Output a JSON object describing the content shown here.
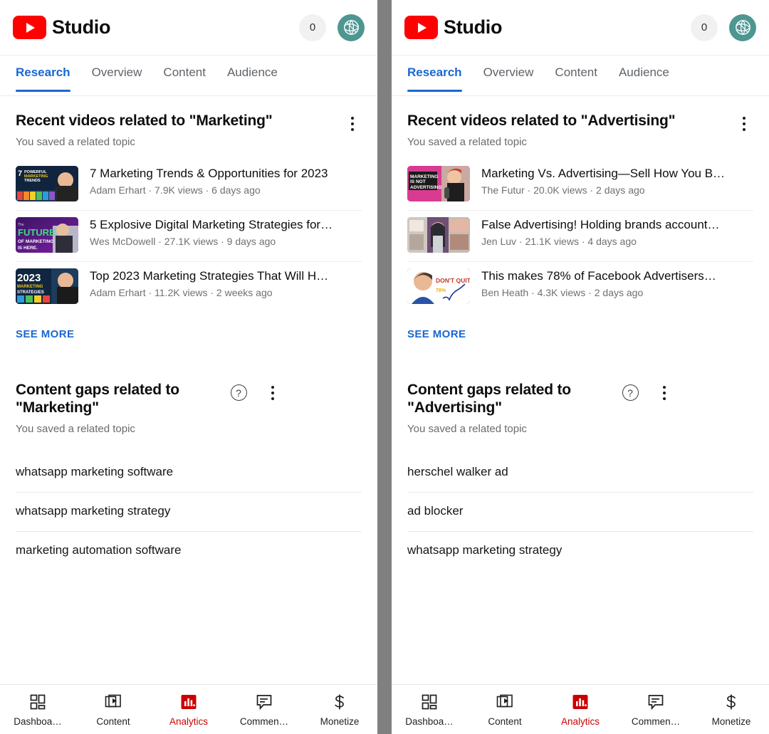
{
  "colors": {
    "brand_red": "#ff0000",
    "accent_blue": "#1967d2",
    "analytics_red": "#cc0000",
    "avatar_teal": "#4e9692",
    "divider_gray": "#808080"
  },
  "appbar": {
    "logo_icon": "youtube-play-icon",
    "title": "Studio",
    "notification_count": "0",
    "avatar_icon": "globe-leaf-avatar-icon"
  },
  "tabs": [
    {
      "label": "Research",
      "active": true
    },
    {
      "label": "Overview",
      "active": false
    },
    {
      "label": "Content",
      "active": false
    },
    {
      "label": "Audience",
      "active": false
    }
  ],
  "bottom_nav": [
    {
      "label": "Dashboa…",
      "icon": "dashboard-grid-icon",
      "active": false
    },
    {
      "label": "Content",
      "icon": "video-stack-icon",
      "active": false
    },
    {
      "label": "Analytics",
      "icon": "bar-chart-icon",
      "active": true
    },
    {
      "label": "Commen…",
      "icon": "comment-bubble-icon",
      "active": false
    },
    {
      "label": "Monetize",
      "icon": "dollar-sign-icon",
      "active": false
    }
  ],
  "panels": [
    {
      "id": "left",
      "recent": {
        "title": "Recent videos related to \"Marketing\"",
        "subtitle": "You saved a related topic",
        "menu_icon": "kebab-menu-icon",
        "see_more": "SEE MORE",
        "videos": [
          {
            "title": "7 Marketing Trends & Opportunities for 2023",
            "meta": "Adam Erhart · 7.9K views · 6 days ago",
            "thumb_text": "7 POWERFUL MARKETING TRENDS"
          },
          {
            "title": "5 Explosive Digital Marketing Strategies for…",
            "meta": "Wes McDowell · 27.1K views · 9 days ago",
            "thumb_text": "THE FUTURE OF MARKETING IS HERE."
          },
          {
            "title": "Top 2023 Marketing Strategies That Will H…",
            "meta": "Adam Erhart · 11.2K views · 2 weeks ago",
            "thumb_text": "2023 MARKETING STRATEGIES"
          }
        ]
      },
      "gaps": {
        "title": "Content gaps related to \"Marketing\"",
        "subtitle": "You saved a related topic",
        "help_icon": "help-question-icon",
        "menu_icon": "kebab-menu-icon",
        "items": [
          "whatsapp marketing software",
          "whatsapp marketing strategy",
          "marketing automation software"
        ]
      }
    },
    {
      "id": "right",
      "recent": {
        "title": "Recent videos related to \"Advertising\"",
        "subtitle": "You saved a related topic",
        "menu_icon": "kebab-menu-icon",
        "see_more": "SEE MORE",
        "videos": [
          {
            "title": "Marketing Vs. Advertising—Sell How You B…",
            "meta": "The Futur · 20.0K views · 2 days ago",
            "thumb_text": "MARKETING IS NOT ADVERTISING"
          },
          {
            "title": "False Advertising! Holding brands account…",
            "meta": "Jen Luv · 21.1K views · 4 days ago",
            "thumb_text": "collage of ad posters"
          },
          {
            "title": "This makes 78% of Facebook Advertisers…",
            "meta": "Ben Heath · 4.3K views · 2 days ago",
            "thumb_text": "DON'T QUIT"
          }
        ]
      },
      "gaps": {
        "title": "Content gaps related to \"Advertising\"",
        "subtitle": "You saved a related topic",
        "help_icon": "help-question-icon",
        "menu_icon": "kebab-menu-icon",
        "items": [
          "herschel walker ad",
          "ad blocker",
          "whatsapp marketing strategy"
        ]
      }
    }
  ]
}
